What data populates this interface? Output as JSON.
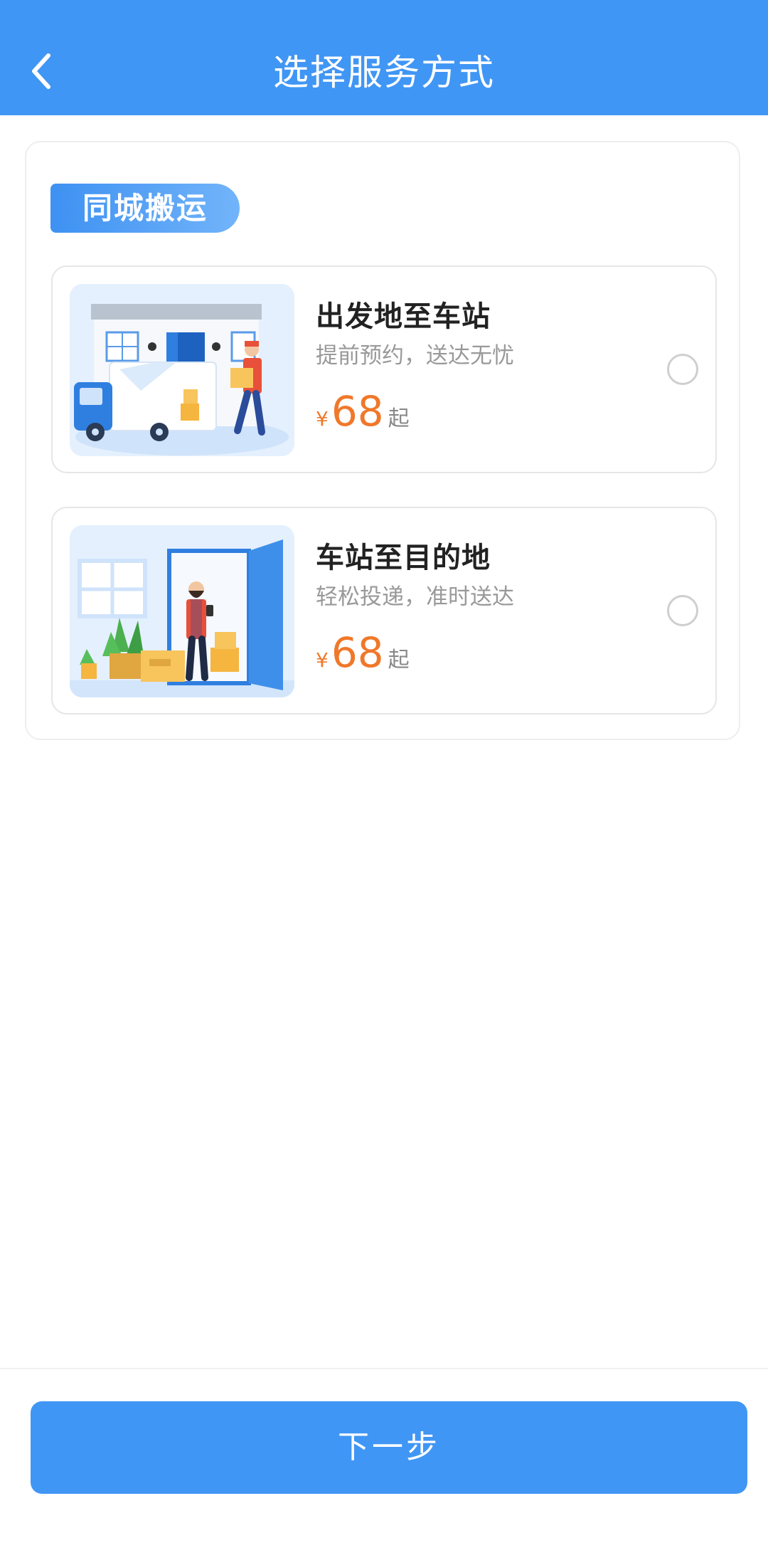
{
  "header": {
    "title": "选择服务方式",
    "back_icon": "chevron-left-icon",
    "background": "#4096F4"
  },
  "category": {
    "label": "同城搬运"
  },
  "options": [
    {
      "title": "出发地至车站",
      "subtitle": "提前预约，送达无忧",
      "currency": "¥",
      "price": "68",
      "price_suffix": "起",
      "selected": false,
      "image": "moving-truck-illustration"
    },
    {
      "title": "车站至目的地",
      "subtitle": "轻松投递，准时送达",
      "currency": "¥",
      "price": "68",
      "price_suffix": "起",
      "selected": false,
      "image": "doorstep-delivery-illustration"
    }
  ],
  "footer": {
    "next_label": "下一步"
  },
  "colors": {
    "primary": "#4096F4",
    "price": "#F0782A",
    "subtitle": "#999999"
  }
}
